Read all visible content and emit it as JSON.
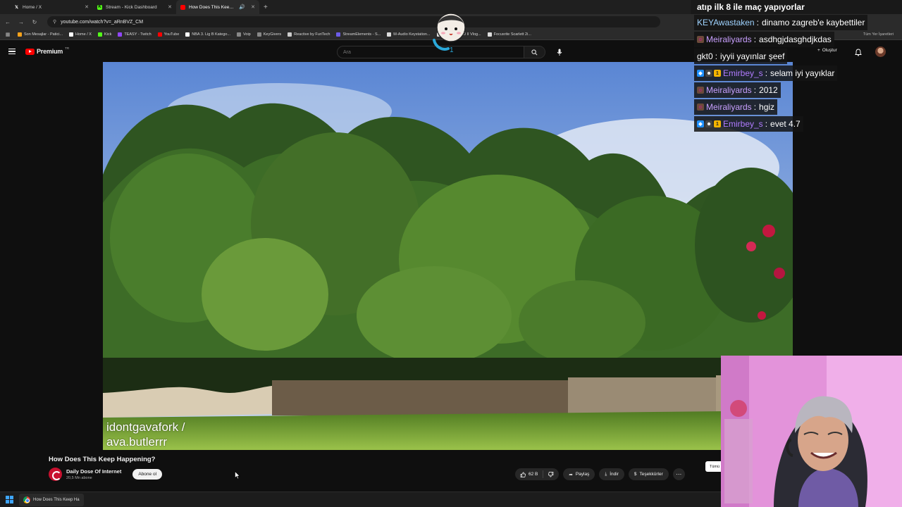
{
  "browser": {
    "tabs": [
      {
        "label": "Home / X",
        "icon": "x-logo-icon",
        "color": "#ffffff",
        "active": false
      },
      {
        "label": "Stream - Kick Dashboard",
        "icon": "kick-logo-icon",
        "color": "#53fc18",
        "active": false
      },
      {
        "label": "How Does This Keep Happ",
        "icon": "youtube-logo-icon",
        "color": "#ff0000",
        "active": true
      }
    ],
    "url": "youtube.com/watch?v=_aRnBVZ_CM",
    "bookmarks": [
      {
        "label": "Son Mesajlar - Patici...",
        "color": "#f7a21b"
      },
      {
        "label": "Home / X",
        "color": "#ffffff"
      },
      {
        "label": "Kick",
        "color": "#53fc18"
      },
      {
        "label": "TEASY - Twitch",
        "color": "#9146ff"
      },
      {
        "label": "YouTube",
        "color": "#ff0000"
      },
      {
        "label": "NBA 3. Lig B Katego...",
        "color": "#ffffff"
      },
      {
        "label": "Voip",
        "color": "#888888"
      },
      {
        "label": "KeyGivers",
        "color": "#888888"
      },
      {
        "label": "Reactive by FuriTech",
        "color": "#cccccc"
      },
      {
        "label": "StreamElements - S...",
        "color": "#6c5ce7"
      },
      {
        "label": "M-Audio Keystation...",
        "color": "#dddddd"
      },
      {
        "label": "Sony ZV-E10 II Vlog...",
        "color": "#dddddd"
      },
      {
        "label": "Focusrite Scarlett 2i...",
        "color": "#dddddd"
      }
    ],
    "bookmarks_right": "Tüm Yer İşaretleri"
  },
  "youtube": {
    "logo_text": "Premium",
    "logo_sup": "TR",
    "search_placeholder": "Ara",
    "create_label": "Oluştur",
    "watermark": [
      "idontgavafork /",
      "ava.butlerrr"
    ],
    "video_title": "How Does This Keep Happening?",
    "channel_name": "Daily Dose Of Internet",
    "channel_subs": "20,5 Mn abone",
    "subscribe_label": "Abone ol",
    "likes": "62 B",
    "share_label": "Paylaş",
    "download_label": "İndir",
    "thanks_label": "Teşekkürler",
    "sort_label": "Tümü"
  },
  "taskbar": {
    "app_label": "How Does This Keep Ha"
  },
  "chat": [
    {
      "user": "",
      "text": "atıp ilk 8 ile maç yapıyorlar",
      "color": "#ffffff",
      "badges": []
    },
    {
      "user": "KEYAwastaken",
      "text": "dinamo zagreb'e kaybettiler",
      "color": "#9fd3ff",
      "badges": []
    },
    {
      "user": "Meiraliyards",
      "text": "asdhgjdasghdjkdas",
      "color": "#c9a0ff",
      "badges": [
        "avatar"
      ]
    },
    {
      "user": "gkt0",
      "text": "iyyii yayınlar şeef",
      "color": "#ffffff",
      "badges": []
    },
    {
      "user": "Emirbey_s",
      "text": "selam iyi yayıklar",
      "color": "#b07bff",
      "badges": [
        "gem",
        "mask",
        "coin"
      ]
    },
    {
      "user": "Meiraliyards",
      "text": "2012",
      "color": "#c9a0ff",
      "badges": [
        "avatar"
      ]
    },
    {
      "user": "Meiraliyards",
      "text": "hgiz",
      "color": "#c9a0ff",
      "badges": [
        "avatar"
      ]
    },
    {
      "user": "Emirbey_s",
      "text": "evet 4.7",
      "color": "#b07bff",
      "badges": [
        "gem",
        "mask",
        "coin"
      ]
    }
  ],
  "overlay": {
    "mascot_count": "1"
  }
}
